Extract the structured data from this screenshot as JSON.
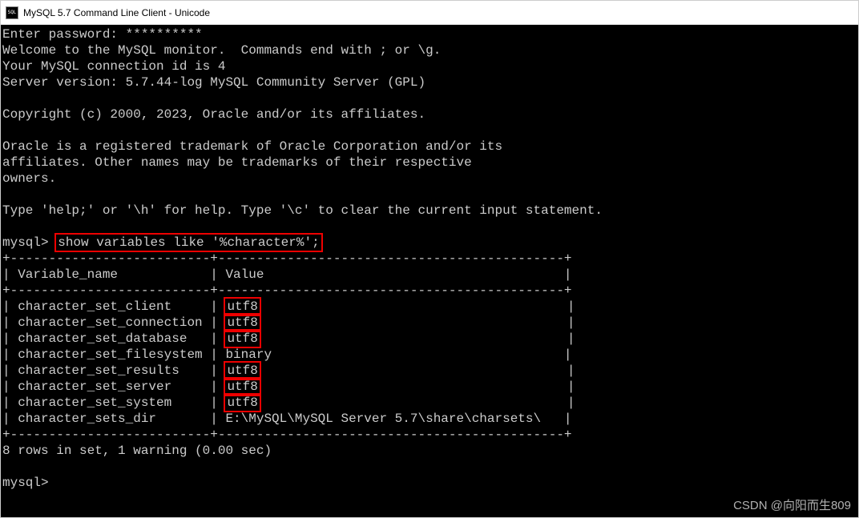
{
  "window": {
    "title": "MySQL 5.7 Command Line Client - Unicode",
    "icon_label": "mysql-icon"
  },
  "session": {
    "password_prompt": "Enter password: **********",
    "welcome": "Welcome to the MySQL monitor.  Commands end with ; or \\g.",
    "connection_id": "Your MySQL connection id is 4",
    "server_version": "Server version: 5.7.44-log MySQL Community Server (GPL)",
    "copyright": "Copyright (c) 2000, 2023, Oracle and/or its affiliates.",
    "trademark1": "Oracle is a registered trademark of Oracle Corporation and/or its",
    "trademark2": "affiliates. Other names may be trademarks of their respective",
    "trademark3": "owners.",
    "help_line": "Type 'help;' or '\\h' for help. Type '\\c' to clear the current input statement."
  },
  "prompt": {
    "label": "mysql>",
    "command": "show variables like '%character%';"
  },
  "table": {
    "border_top": "+--------------------------+----------------------------------------+",
    "header_name": "Variable_name",
    "header_value": "Value",
    "rows": [
      {
        "name": "character_set_client",
        "value": "utf8",
        "hl": true
      },
      {
        "name": "character_set_connection",
        "value": "utf8",
        "hl": true
      },
      {
        "name": "character_set_database",
        "value": "utf8",
        "hl": true
      },
      {
        "name": "character_set_filesystem",
        "value": "binary",
        "hl": false
      },
      {
        "name": "character_set_results",
        "value": "utf8",
        "hl": true
      },
      {
        "name": "character_set_server",
        "value": "utf8",
        "hl": true
      },
      {
        "name": "character_set_system",
        "value": "utf8",
        "hl": true
      },
      {
        "name": "character_sets_dir",
        "value": "E:\\MySQL\\MySQL Server 5.7\\share\\charsets\\",
        "hl": false
      }
    ],
    "footer": "8 rows in set, 1 warning (0.00 sec)"
  },
  "prompt2": {
    "label": "mysql>"
  },
  "watermark": "CSDN @向阳而生809"
}
